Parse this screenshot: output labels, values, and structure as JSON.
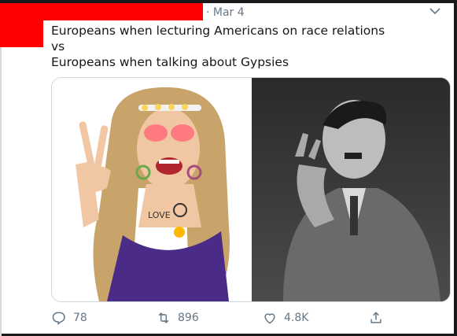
{
  "tweet": {
    "date": "· Mar 4",
    "text": "Europeans when lecturing Americans on race relations\nvs\nEuropeans when talking about Gypsies"
  },
  "media": {
    "left_image": "meme photo",
    "right_image": "black and white photo"
  },
  "actions": {
    "replies": "78",
    "retweets": "896",
    "likes": "4.8K"
  },
  "icons": {
    "reply": "comment-icon",
    "retweet": "retweet-icon",
    "like": "heart-icon",
    "share": "share-icon",
    "caret": "chevron-down-icon"
  },
  "colors": {
    "redaction": "#ff0000",
    "muted_text": "#657786",
    "text": "#14171a"
  }
}
